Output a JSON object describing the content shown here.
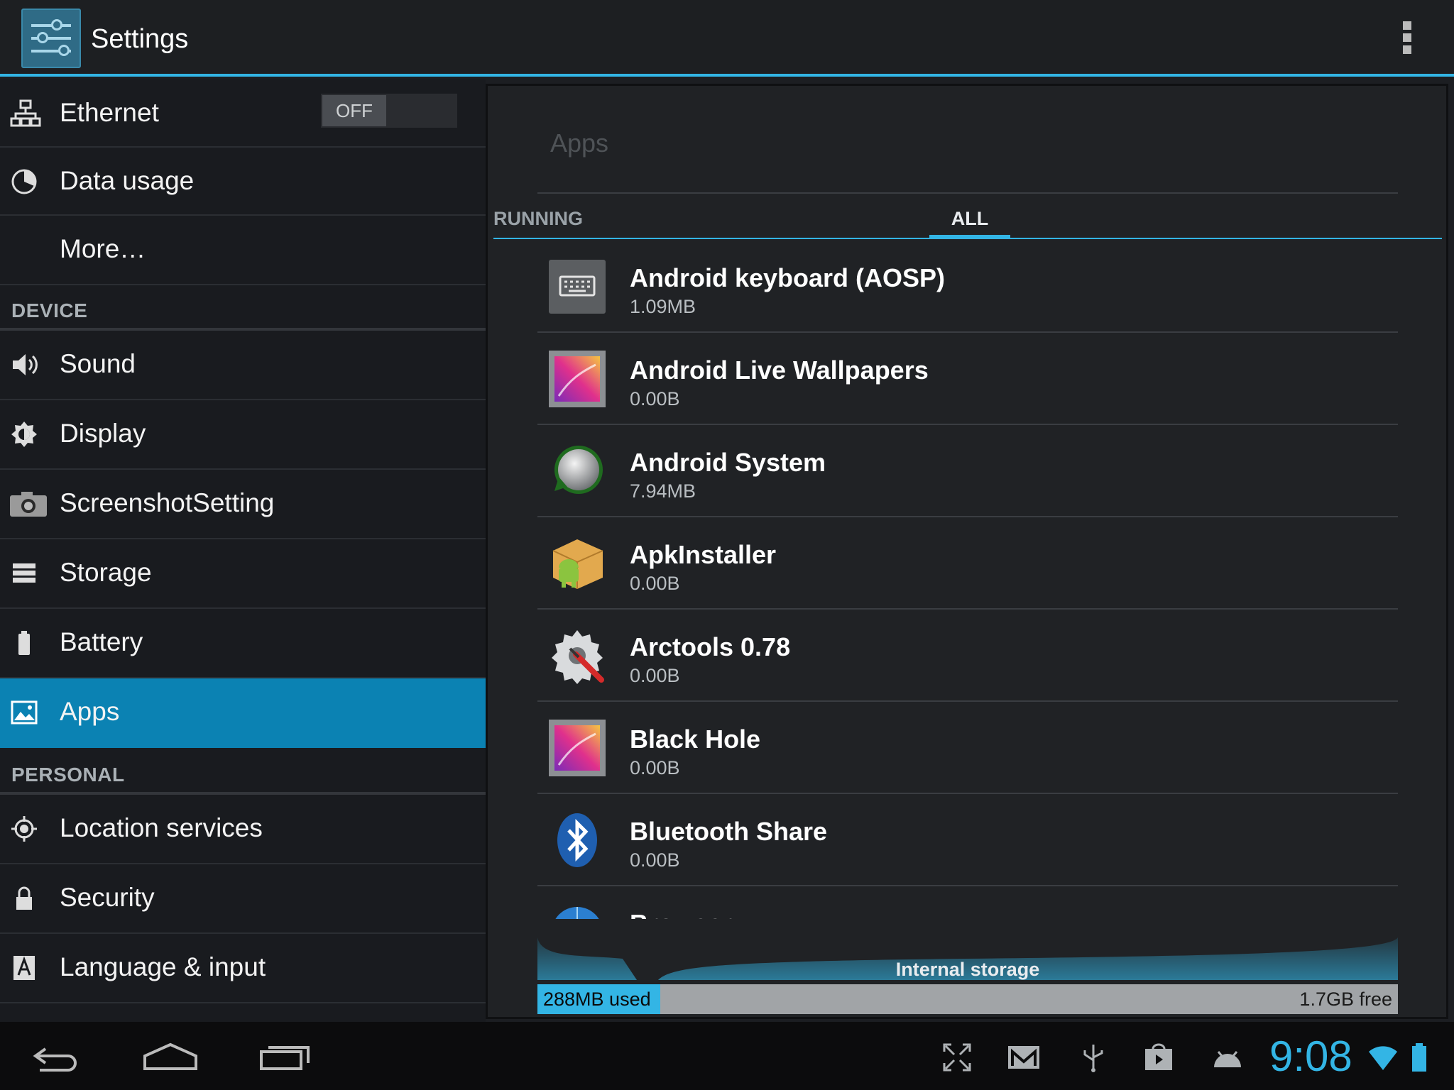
{
  "actionbar": {
    "title": "Settings",
    "menu_icon": "overflow-menu-icon"
  },
  "sidebar": {
    "wireless": [
      {
        "label": "Ethernet",
        "icon": "ethernet-icon",
        "toggle": "OFF"
      },
      {
        "label": "Data usage",
        "icon": "data-usage-icon"
      },
      {
        "label": "More…"
      }
    ],
    "device_header": "DEVICE",
    "device": [
      {
        "label": "Sound",
        "icon": "speaker-icon"
      },
      {
        "label": "Display",
        "icon": "display-brightness-icon"
      },
      {
        "label": "ScreenshotSetting",
        "icon": "camera-icon"
      },
      {
        "label": "Storage",
        "icon": "storage-icon"
      },
      {
        "label": "Battery",
        "icon": "battery-icon"
      },
      {
        "label": "Apps",
        "icon": "apps-icon",
        "selected": true
      }
    ],
    "personal_header": "PERSONAL",
    "personal": [
      {
        "label": "Location services",
        "icon": "location-icon"
      },
      {
        "label": "Security",
        "icon": "lock-icon"
      },
      {
        "label": "Language & input",
        "icon": "keyboard-letter-icon"
      }
    ]
  },
  "panel": {
    "title": "Apps",
    "tabs": [
      "RUNNING",
      "ALL"
    ],
    "selected_tab": "ALL",
    "apps": [
      {
        "name": "Android keyboard (AOSP)",
        "size": "1.09MB"
      },
      {
        "name": "Android Live Wallpapers",
        "size": "0.00B"
      },
      {
        "name": "Android System",
        "size": "7.94MB"
      },
      {
        "name": "ApkInstaller",
        "size": "0.00B"
      },
      {
        "name": "Arctools 0.78",
        "size": "0.00B"
      },
      {
        "name": "Black Hole",
        "size": "0.00B"
      },
      {
        "name": "Bluetooth Share",
        "size": "0.00B"
      },
      {
        "name": "Browser",
        "size": ""
      }
    ],
    "storage": {
      "label": "Internal storage",
      "used": "288MB used",
      "free": "1.7GB free",
      "used_fraction": 0.143
    }
  },
  "statusbar": {
    "time": "9:08"
  },
  "colors": {
    "accent": "#33b5e5",
    "selected": "#0b82b3"
  }
}
